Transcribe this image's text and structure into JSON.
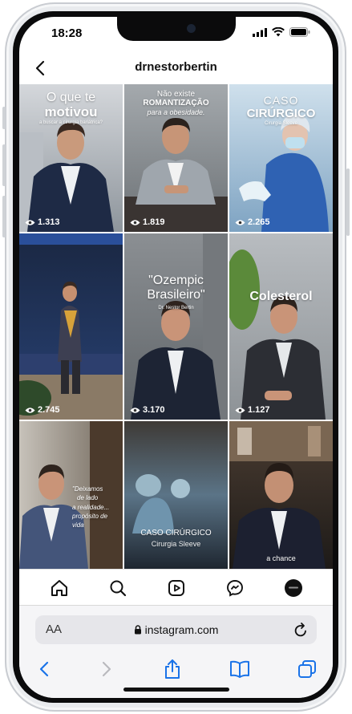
{
  "status_bar": {
    "time": "18:28"
  },
  "header": {
    "username": "drnestorbertin"
  },
  "grid": {
    "tiles": [
      {
        "title_line1": "O que te",
        "title_line2": "motivou",
        "caption": "a buscar a cirurgia bariátrica?",
        "views": "1.313"
      },
      {
        "title_line1": "Não existe",
        "title_line2": "ROMANTIZAÇÃO",
        "caption": "para a obesidade.",
        "views": "1.819"
      },
      {
        "title_line1": "CASO",
        "title_line2": "CIRÚRGICO",
        "caption": "Cirurgia Sleeve",
        "views": "2.265"
      },
      {
        "title_line1": "",
        "title_line2": "",
        "caption": "",
        "views": "2.745"
      },
      {
        "title_line1": "\"Ozempic",
        "title_line2": "Brasileiro\"",
        "caption": "Dr. Nestor Bertin",
        "views": "3.170"
      },
      {
        "title_line1": "Colesterol",
        "title_line2": "",
        "caption": "",
        "views": "1.127"
      },
      {
        "title_line1": "\"Deixamos",
        "title_line2": "de lado",
        "caption": "a realidade... propósito de vida",
        "views": ""
      },
      {
        "title_line1": "CASO CIRÚRGICO",
        "title_line2": "Cirurgia Sleeve",
        "caption": "",
        "views": ""
      },
      {
        "title_line1": "",
        "title_line2": "",
        "caption": "a chance",
        "views": ""
      }
    ]
  },
  "tab_bar": {
    "items": [
      {
        "icon": "home-icon"
      },
      {
        "icon": "search-icon"
      },
      {
        "icon": "reels-icon"
      },
      {
        "icon": "messenger-icon"
      },
      {
        "icon": "profile-avatar"
      }
    ]
  },
  "browser": {
    "text_size_label": "AA",
    "url": "instagram.com"
  }
}
